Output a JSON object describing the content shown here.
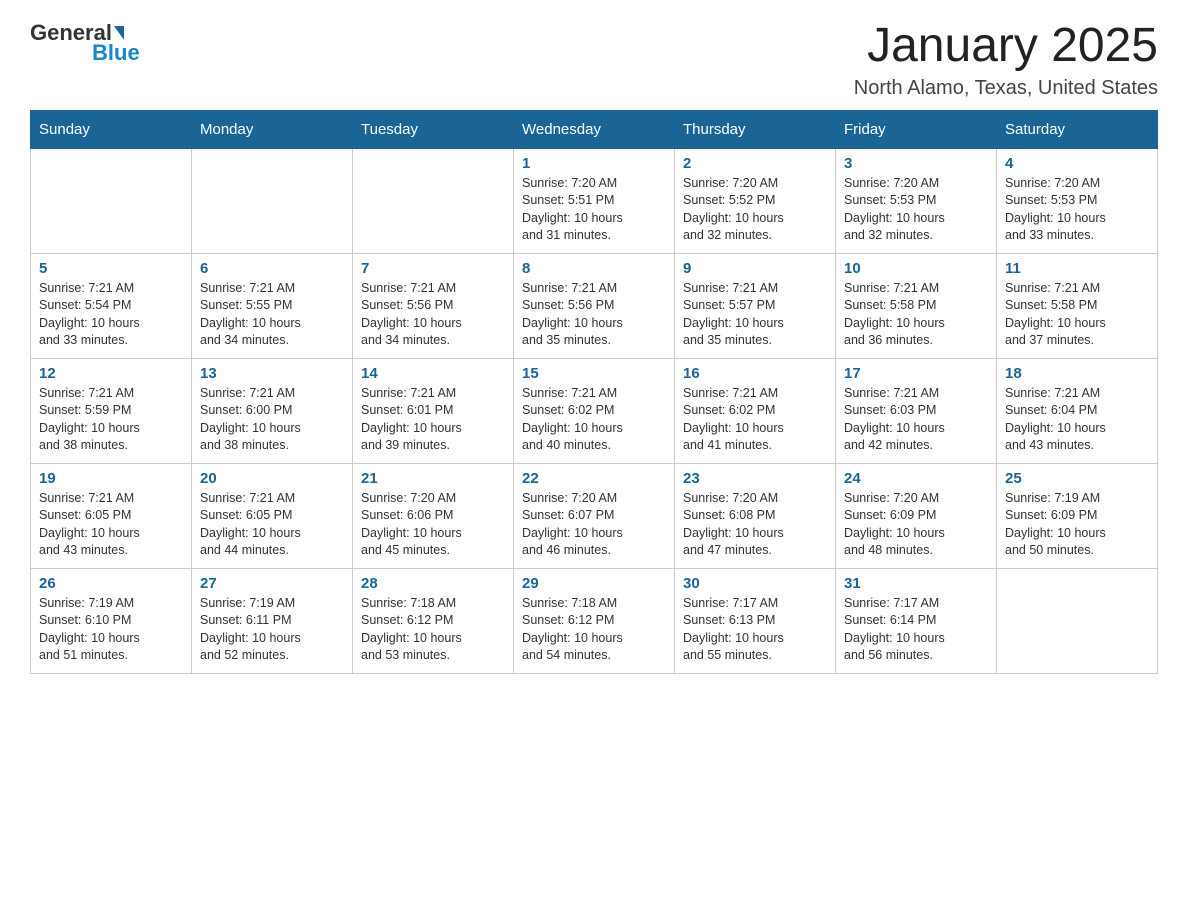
{
  "header": {
    "logo": {
      "general": "General",
      "blue": "Blue"
    },
    "title": "January 2025",
    "location": "North Alamo, Texas, United States"
  },
  "days_of_week": [
    "Sunday",
    "Monday",
    "Tuesday",
    "Wednesday",
    "Thursday",
    "Friday",
    "Saturday"
  ],
  "weeks": [
    [
      {
        "day": "",
        "info": ""
      },
      {
        "day": "",
        "info": ""
      },
      {
        "day": "",
        "info": ""
      },
      {
        "day": "1",
        "info": "Sunrise: 7:20 AM\nSunset: 5:51 PM\nDaylight: 10 hours\nand 31 minutes."
      },
      {
        "day": "2",
        "info": "Sunrise: 7:20 AM\nSunset: 5:52 PM\nDaylight: 10 hours\nand 32 minutes."
      },
      {
        "day": "3",
        "info": "Sunrise: 7:20 AM\nSunset: 5:53 PM\nDaylight: 10 hours\nand 32 minutes."
      },
      {
        "day": "4",
        "info": "Sunrise: 7:20 AM\nSunset: 5:53 PM\nDaylight: 10 hours\nand 33 minutes."
      }
    ],
    [
      {
        "day": "5",
        "info": "Sunrise: 7:21 AM\nSunset: 5:54 PM\nDaylight: 10 hours\nand 33 minutes."
      },
      {
        "day": "6",
        "info": "Sunrise: 7:21 AM\nSunset: 5:55 PM\nDaylight: 10 hours\nand 34 minutes."
      },
      {
        "day": "7",
        "info": "Sunrise: 7:21 AM\nSunset: 5:56 PM\nDaylight: 10 hours\nand 34 minutes."
      },
      {
        "day": "8",
        "info": "Sunrise: 7:21 AM\nSunset: 5:56 PM\nDaylight: 10 hours\nand 35 minutes."
      },
      {
        "day": "9",
        "info": "Sunrise: 7:21 AM\nSunset: 5:57 PM\nDaylight: 10 hours\nand 35 minutes."
      },
      {
        "day": "10",
        "info": "Sunrise: 7:21 AM\nSunset: 5:58 PM\nDaylight: 10 hours\nand 36 minutes."
      },
      {
        "day": "11",
        "info": "Sunrise: 7:21 AM\nSunset: 5:58 PM\nDaylight: 10 hours\nand 37 minutes."
      }
    ],
    [
      {
        "day": "12",
        "info": "Sunrise: 7:21 AM\nSunset: 5:59 PM\nDaylight: 10 hours\nand 38 minutes."
      },
      {
        "day": "13",
        "info": "Sunrise: 7:21 AM\nSunset: 6:00 PM\nDaylight: 10 hours\nand 38 minutes."
      },
      {
        "day": "14",
        "info": "Sunrise: 7:21 AM\nSunset: 6:01 PM\nDaylight: 10 hours\nand 39 minutes."
      },
      {
        "day": "15",
        "info": "Sunrise: 7:21 AM\nSunset: 6:02 PM\nDaylight: 10 hours\nand 40 minutes."
      },
      {
        "day": "16",
        "info": "Sunrise: 7:21 AM\nSunset: 6:02 PM\nDaylight: 10 hours\nand 41 minutes."
      },
      {
        "day": "17",
        "info": "Sunrise: 7:21 AM\nSunset: 6:03 PM\nDaylight: 10 hours\nand 42 minutes."
      },
      {
        "day": "18",
        "info": "Sunrise: 7:21 AM\nSunset: 6:04 PM\nDaylight: 10 hours\nand 43 minutes."
      }
    ],
    [
      {
        "day": "19",
        "info": "Sunrise: 7:21 AM\nSunset: 6:05 PM\nDaylight: 10 hours\nand 43 minutes."
      },
      {
        "day": "20",
        "info": "Sunrise: 7:21 AM\nSunset: 6:05 PM\nDaylight: 10 hours\nand 44 minutes."
      },
      {
        "day": "21",
        "info": "Sunrise: 7:20 AM\nSunset: 6:06 PM\nDaylight: 10 hours\nand 45 minutes."
      },
      {
        "day": "22",
        "info": "Sunrise: 7:20 AM\nSunset: 6:07 PM\nDaylight: 10 hours\nand 46 minutes."
      },
      {
        "day": "23",
        "info": "Sunrise: 7:20 AM\nSunset: 6:08 PM\nDaylight: 10 hours\nand 47 minutes."
      },
      {
        "day": "24",
        "info": "Sunrise: 7:20 AM\nSunset: 6:09 PM\nDaylight: 10 hours\nand 48 minutes."
      },
      {
        "day": "25",
        "info": "Sunrise: 7:19 AM\nSunset: 6:09 PM\nDaylight: 10 hours\nand 50 minutes."
      }
    ],
    [
      {
        "day": "26",
        "info": "Sunrise: 7:19 AM\nSunset: 6:10 PM\nDaylight: 10 hours\nand 51 minutes."
      },
      {
        "day": "27",
        "info": "Sunrise: 7:19 AM\nSunset: 6:11 PM\nDaylight: 10 hours\nand 52 minutes."
      },
      {
        "day": "28",
        "info": "Sunrise: 7:18 AM\nSunset: 6:12 PM\nDaylight: 10 hours\nand 53 minutes."
      },
      {
        "day": "29",
        "info": "Sunrise: 7:18 AM\nSunset: 6:12 PM\nDaylight: 10 hours\nand 54 minutes."
      },
      {
        "day": "30",
        "info": "Sunrise: 7:17 AM\nSunset: 6:13 PM\nDaylight: 10 hours\nand 55 minutes."
      },
      {
        "day": "31",
        "info": "Sunrise: 7:17 AM\nSunset: 6:14 PM\nDaylight: 10 hours\nand 56 minutes."
      },
      {
        "day": "",
        "info": ""
      }
    ]
  ]
}
